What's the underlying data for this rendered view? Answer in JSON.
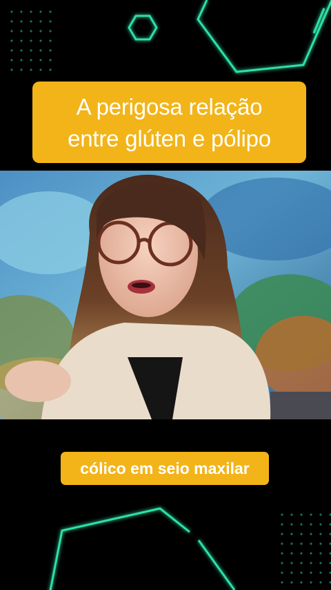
{
  "title": {
    "line1": "A perigosa relação",
    "line2": "entre glúten e pólipo"
  },
  "caption": {
    "text": "cólico em seio maxilar"
  },
  "colors": {
    "background": "#000000",
    "banner": "#f2b418",
    "banner_text": "#ffffff",
    "neon_accent": "#2fe0a8"
  },
  "icons": {
    "top_small_shape": "hexagon-outline-icon",
    "top_large_shape": "hexagon-outline-icon",
    "bottom_large_shape": "hexagon-outline-icon",
    "dot_grids": "dot-grid-pattern"
  }
}
